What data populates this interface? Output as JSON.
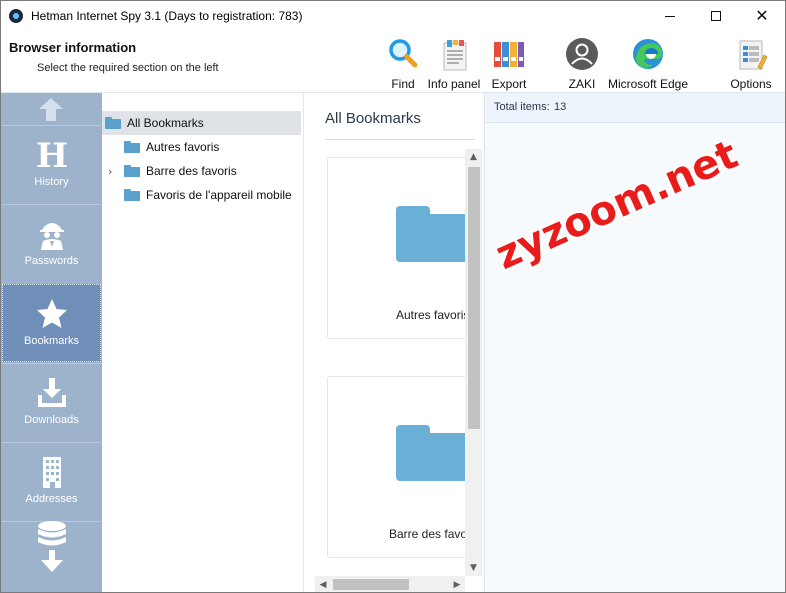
{
  "window": {
    "title": "Hetman Internet Spy 3.1 (Days to registration: 783)"
  },
  "ribbon": {
    "section_title": "Browser information",
    "section_subtitle": "Select the required section on the left",
    "tools": [
      {
        "label": "Find",
        "icon": "magnifier-icon"
      },
      {
        "label": "Info panel",
        "icon": "info-panel-icon"
      },
      {
        "label": "Export",
        "icon": "export-binders-icon"
      },
      {
        "label": "ZAKI",
        "icon": "user-avatar-icon"
      },
      {
        "label": "Microsoft Edge",
        "icon": "edge-browser-icon"
      },
      {
        "label": "Options",
        "icon": "options-icon"
      }
    ]
  },
  "sidebar": {
    "items": [
      {
        "label": "History",
        "icon": "history-h-icon"
      },
      {
        "label": "Passwords",
        "icon": "spy-icon"
      },
      {
        "label": "Bookmarks",
        "icon": "star-icon",
        "active": true
      },
      {
        "label": "Downloads",
        "icon": "download-icon"
      },
      {
        "label": "Addresses",
        "icon": "building-icon"
      }
    ]
  },
  "tree": {
    "root": "All Bookmarks",
    "children": [
      {
        "label": "Autres favoris",
        "expandable": false
      },
      {
        "label": "Barre des favoris",
        "expandable": true
      },
      {
        "label": "Favoris de l'appareil mobile",
        "expandable": false
      }
    ]
  },
  "content": {
    "title": "All Bookmarks",
    "cards": [
      {
        "label": "Autres favoris"
      },
      {
        "label": "Barre des favoris"
      }
    ]
  },
  "info": {
    "total_label": "Total items:",
    "total_value": "13"
  },
  "watermark": "zyzoom.net",
  "colors": {
    "sidebar": "#9db3cc",
    "sidebar_active": "#6f8fb8",
    "folder": "#5aa2cc",
    "watermark": "#ea1b1b"
  }
}
